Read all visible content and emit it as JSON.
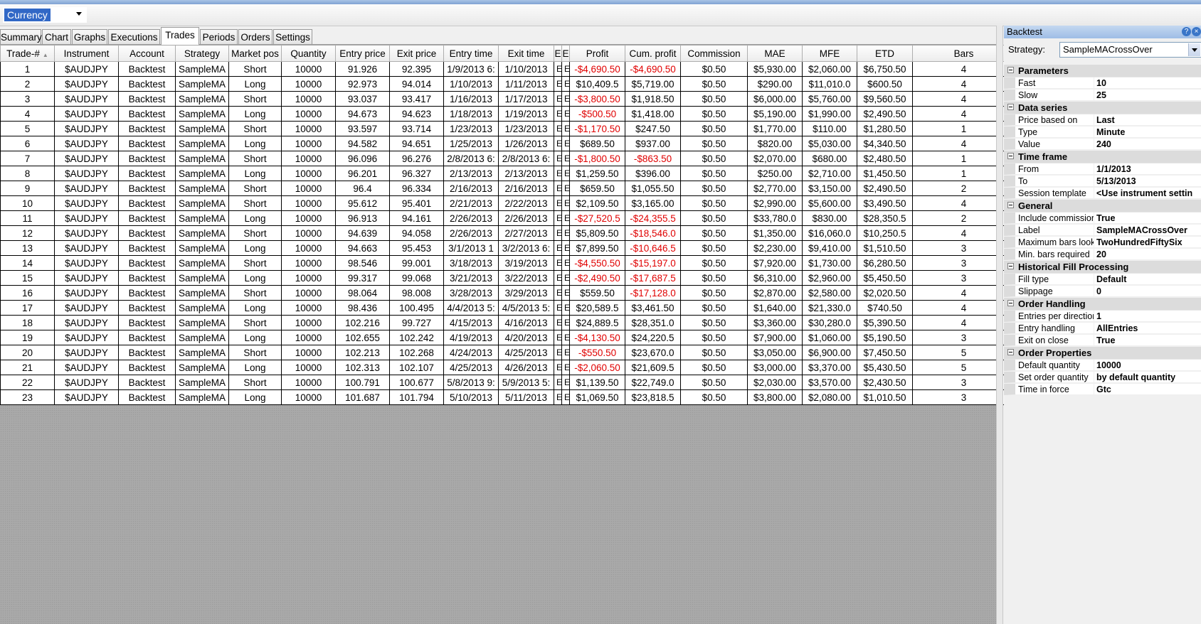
{
  "topbar": {
    "selector_value": "Currency"
  },
  "tabs": [
    "Summary",
    "Chart",
    "Graphs",
    "Executions",
    "Trades",
    "Periods",
    "Orders",
    "Settings"
  ],
  "active_tab": "Trades",
  "table": {
    "columns": [
      "Trade-#",
      "Instrument",
      "Account",
      "Strategy",
      "Market pos",
      "Quantity",
      "Entry price",
      "Exit price",
      "Entry time",
      "Exit time",
      "E",
      "E",
      "Profit",
      "Cum. profit",
      "Commission",
      "MAE",
      "MFE",
      "ETD",
      "Bars"
    ],
    "rows": [
      [
        "1",
        "$AUDJPY",
        "Backtest",
        "SampleMA",
        "Short",
        "10000",
        "91.926",
        "92.395",
        "1/9/2013 6:",
        "1/10/2013",
        "E",
        "E",
        "-$4,690.50",
        "-$4,690.50",
        "$0.50",
        "$5,930.00",
        "$2,060.00",
        "$6,750.50",
        "4"
      ],
      [
        "2",
        "$AUDJPY",
        "Backtest",
        "SampleMA",
        "Long",
        "10000",
        "92.973",
        "94.014",
        "1/10/2013",
        "1/11/2013",
        "E",
        "E",
        "$10,409.5",
        "$5,719.00",
        "$0.50",
        "$290.00",
        "$11,010.0",
        "$600.50",
        "4"
      ],
      [
        "3",
        "$AUDJPY",
        "Backtest",
        "SampleMA",
        "Short",
        "10000",
        "93.037",
        "93.417",
        "1/16/2013",
        "1/17/2013",
        "E",
        "E",
        "-$3,800.50",
        "$1,918.50",
        "$0.50",
        "$6,000.00",
        "$5,760.00",
        "$9,560.50",
        "4"
      ],
      [
        "4",
        "$AUDJPY",
        "Backtest",
        "SampleMA",
        "Long",
        "10000",
        "94.673",
        "94.623",
        "1/18/2013",
        "1/19/2013",
        "E",
        "E",
        "-$500.50",
        "$1,418.00",
        "$0.50",
        "$5,190.00",
        "$1,990.00",
        "$2,490.50",
        "4"
      ],
      [
        "5",
        "$AUDJPY",
        "Backtest",
        "SampleMA",
        "Short",
        "10000",
        "93.597",
        "93.714",
        "1/23/2013",
        "1/23/2013",
        "E",
        "E",
        "-$1,170.50",
        "$247.50",
        "$0.50",
        "$1,770.00",
        "$110.00",
        "$1,280.50",
        "1"
      ],
      [
        "6",
        "$AUDJPY",
        "Backtest",
        "SampleMA",
        "Long",
        "10000",
        "94.582",
        "94.651",
        "1/25/2013",
        "1/26/2013",
        "E",
        "E",
        "$689.50",
        "$937.00",
        "$0.50",
        "$820.00",
        "$5,030.00",
        "$4,340.50",
        "4"
      ],
      [
        "7",
        "$AUDJPY",
        "Backtest",
        "SampleMA",
        "Short",
        "10000",
        "96.096",
        "96.276",
        "2/8/2013 6:",
        "2/8/2013 6:",
        "E",
        "E",
        "-$1,800.50",
        "-$863.50",
        "$0.50",
        "$2,070.00",
        "$680.00",
        "$2,480.50",
        "1"
      ],
      [
        "8",
        "$AUDJPY",
        "Backtest",
        "SampleMA",
        "Long",
        "10000",
        "96.201",
        "96.327",
        "2/13/2013",
        "2/13/2013",
        "E",
        "E",
        "$1,259.50",
        "$396.00",
        "$0.50",
        "$250.00",
        "$2,710.00",
        "$1,450.50",
        "1"
      ],
      [
        "9",
        "$AUDJPY",
        "Backtest",
        "SampleMA",
        "Short",
        "10000",
        "96.4",
        "96.334",
        "2/16/2013",
        "2/16/2013",
        "E",
        "E",
        "$659.50",
        "$1,055.50",
        "$0.50",
        "$2,770.00",
        "$3,150.00",
        "$2,490.50",
        "2"
      ],
      [
        "10",
        "$AUDJPY",
        "Backtest",
        "SampleMA",
        "Short",
        "10000",
        "95.612",
        "95.401",
        "2/21/2013",
        "2/22/2013",
        "E",
        "E",
        "$2,109.50",
        "$3,165.00",
        "$0.50",
        "$2,990.00",
        "$5,600.00",
        "$3,490.50",
        "4"
      ],
      [
        "11",
        "$AUDJPY",
        "Backtest",
        "SampleMA",
        "Long",
        "10000",
        "96.913",
        "94.161",
        "2/26/2013",
        "2/26/2013",
        "E",
        "E",
        "-$27,520.5",
        "-$24,355.5",
        "$0.50",
        "$33,780.0",
        "$830.00",
        "$28,350.5",
        "2"
      ],
      [
        "12",
        "$AUDJPY",
        "Backtest",
        "SampleMA",
        "Short",
        "10000",
        "94.639",
        "94.058",
        "2/26/2013",
        "2/27/2013",
        "E",
        "E",
        "$5,809.50",
        "-$18,546.0",
        "$0.50",
        "$1,350.00",
        "$16,060.0",
        "$10,250.5",
        "4"
      ],
      [
        "13",
        "$AUDJPY",
        "Backtest",
        "SampleMA",
        "Long",
        "10000",
        "94.663",
        "95.453",
        "3/1/2013 1",
        "3/2/2013 6:",
        "E",
        "E",
        "$7,899.50",
        "-$10,646.5",
        "$0.50",
        "$2,230.00",
        "$9,410.00",
        "$1,510.50",
        "3"
      ],
      [
        "14",
        "$AUDJPY",
        "Backtest",
        "SampleMA",
        "Short",
        "10000",
        "98.546",
        "99.001",
        "3/18/2013",
        "3/19/2013",
        "E",
        "E",
        "-$4,550.50",
        "-$15,197.0",
        "$0.50",
        "$7,920.00",
        "$1,730.00",
        "$6,280.50",
        "3"
      ],
      [
        "15",
        "$AUDJPY",
        "Backtest",
        "SampleMA",
        "Long",
        "10000",
        "99.317",
        "99.068",
        "3/21/2013",
        "3/22/2013",
        "E",
        "E",
        "-$2,490.50",
        "-$17,687.5",
        "$0.50",
        "$6,310.00",
        "$2,960.00",
        "$5,450.50",
        "3"
      ],
      [
        "16",
        "$AUDJPY",
        "Backtest",
        "SampleMA",
        "Short",
        "10000",
        "98.064",
        "98.008",
        "3/28/2013",
        "3/29/2013",
        "E",
        "E",
        "$559.50",
        "-$17,128.0",
        "$0.50",
        "$2,870.00",
        "$2,580.00",
        "$2,020.50",
        "4"
      ],
      [
        "17",
        "$AUDJPY",
        "Backtest",
        "SampleMA",
        "Long",
        "10000",
        "98.436",
        "100.495",
        "4/4/2013 5:",
        "4/5/2013 5:",
        "E",
        "E",
        "$20,589.5",
        "$3,461.50",
        "$0.50",
        "$1,640.00",
        "$21,330.0",
        "$740.50",
        "4"
      ],
      [
        "18",
        "$AUDJPY",
        "Backtest",
        "SampleMA",
        "Short",
        "10000",
        "102.216",
        "99.727",
        "4/15/2013",
        "4/16/2013",
        "E",
        "E",
        "$24,889.5",
        "$28,351.0",
        "$0.50",
        "$3,360.00",
        "$30,280.0",
        "$5,390.50",
        "4"
      ],
      [
        "19",
        "$AUDJPY",
        "Backtest",
        "SampleMA",
        "Long",
        "10000",
        "102.655",
        "102.242",
        "4/19/2013",
        "4/20/2013",
        "E",
        "E",
        "-$4,130.50",
        "$24,220.5",
        "$0.50",
        "$7,900.00",
        "$1,060.00",
        "$5,190.50",
        "3"
      ],
      [
        "20",
        "$AUDJPY",
        "Backtest",
        "SampleMA",
        "Short",
        "10000",
        "102.213",
        "102.268",
        "4/24/2013",
        "4/25/2013",
        "E",
        "E",
        "-$550.50",
        "$23,670.0",
        "$0.50",
        "$3,050.00",
        "$6,900.00",
        "$7,450.50",
        "5"
      ],
      [
        "21",
        "$AUDJPY",
        "Backtest",
        "SampleMA",
        "Long",
        "10000",
        "102.313",
        "102.107",
        "4/25/2013",
        "4/26/2013",
        "E",
        "E",
        "-$2,060.50",
        "$21,609.5",
        "$0.50",
        "$3,000.00",
        "$3,370.00",
        "$5,430.50",
        "5"
      ],
      [
        "22",
        "$AUDJPY",
        "Backtest",
        "SampleMA",
        "Short",
        "10000",
        "100.791",
        "100.677",
        "5/8/2013 9:",
        "5/9/2013 5:",
        "E",
        "E",
        "$1,139.50",
        "$22,749.0",
        "$0.50",
        "$2,030.00",
        "$3,570.00",
        "$2,430.50",
        "3"
      ],
      [
        "23",
        "$AUDJPY",
        "Backtest",
        "SampleMA",
        "Long",
        "10000",
        "101.687",
        "101.794",
        "5/10/2013",
        "5/11/2013",
        "E",
        "E",
        "$1,069.50",
        "$23,818.5",
        "$0.50",
        "$3,800.00",
        "$2,080.00",
        "$1,010.50",
        "3"
      ]
    ]
  },
  "panel": {
    "title": "Backtest",
    "strategy_label": "Strategy:",
    "strategy_value": "SampleMACrossOver",
    "categories": [
      {
        "name": "Parameters",
        "props": [
          [
            "Fast",
            "10"
          ],
          [
            "Slow",
            "25"
          ]
        ]
      },
      {
        "name": "Data series",
        "props": [
          [
            "Price based on",
            "Last"
          ],
          [
            "Type",
            "Minute"
          ],
          [
            "Value",
            "240"
          ]
        ]
      },
      {
        "name": "Time frame",
        "props": [
          [
            "From",
            "1/1/2013"
          ],
          [
            "To",
            "5/13/2013"
          ],
          [
            "Session template",
            "<Use instrument settin"
          ]
        ]
      },
      {
        "name": "General",
        "props": [
          [
            "Include commission",
            "True"
          ],
          [
            "Label",
            "SampleMACrossOver"
          ],
          [
            "Maximum bars look",
            "TwoHundredFiftySix"
          ],
          [
            "Min. bars required",
            "20"
          ]
        ]
      },
      {
        "name": "Historical Fill Processing",
        "props": [
          [
            "Fill type",
            "Default"
          ],
          [
            "Slippage",
            "0"
          ]
        ]
      },
      {
        "name": "Order Handling",
        "props": [
          [
            "Entries per direction",
            "1"
          ],
          [
            "Entry handling",
            "AllEntries"
          ],
          [
            "Exit on close",
            "True"
          ]
        ]
      },
      {
        "name": "Order Properties",
        "props": [
          [
            "Default quantity",
            "10000"
          ],
          [
            "Set order quantity",
            "by default quantity"
          ],
          [
            "Time in force",
            "Gtc"
          ]
        ]
      }
    ]
  },
  "colors": {
    "negative": "#e00000",
    "selection": "#3168c6",
    "panel_title": "#9ebde6"
  }
}
